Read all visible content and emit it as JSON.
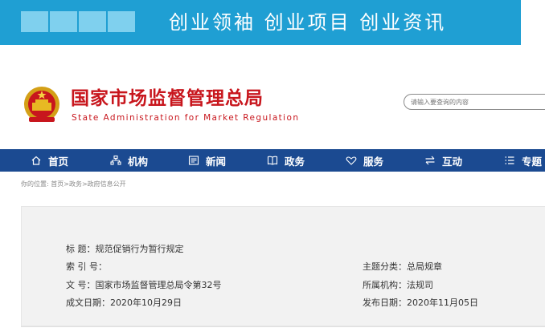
{
  "banner": {
    "text": "创业领袖  创业项目  创业资讯",
    "bg_color": "#1f9fd3"
  },
  "header": {
    "emblem_icon": "national-emblem-icon",
    "site_name": "国家市场监督管理总局",
    "site_name_en": "State Administration for Market Regulation",
    "brand_color": "#c8161d"
  },
  "search": {
    "placeholder": "请输入要查询的内容"
  },
  "nav": {
    "bg_color": "#1b4a91",
    "items": [
      {
        "label": "首页",
        "icon": "home-icon"
      },
      {
        "label": "机构",
        "icon": "org-chart-icon"
      },
      {
        "label": "新闻",
        "icon": "news-icon"
      },
      {
        "label": "政务",
        "icon": "book-icon"
      },
      {
        "label": "服务",
        "icon": "heart-icon"
      },
      {
        "label": "互动",
        "icon": "exchange-icon"
      },
      {
        "label": "专题",
        "icon": "list-icon"
      }
    ]
  },
  "breadcrumb": "你的位置: 首页>政务>政府信息公开",
  "info": {
    "title_label": "标      题：",
    "title_value": "规范促销行为暂行规定",
    "index_label": "索  引  号：",
    "index_value": "",
    "doc_label": "文      号：",
    "doc_value": "国家市场监督管理总局令第32号",
    "date_label": "成文日期：",
    "date_value": "2020年10月29日",
    "category_label": "主题分类：",
    "category_value": "总局规章",
    "org_label": "所属机构：",
    "org_value": "法规司",
    "publish_label": "发布日期：",
    "publish_value": "2020年11月05日"
  }
}
